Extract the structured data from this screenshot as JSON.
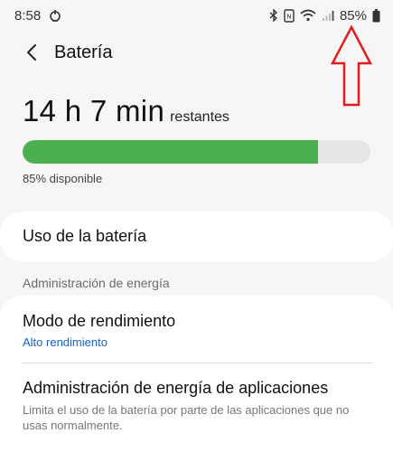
{
  "status_bar": {
    "time": "8:58",
    "battery_percent": "85%",
    "icons": [
      "notification-app-icon",
      "bluetooth-icon",
      "nfc-icon",
      "wifi-icon",
      "signal-icon",
      "battery-icon"
    ]
  },
  "header": {
    "back_icon": "chevron-left-icon",
    "title": "Batería"
  },
  "battery": {
    "time_remaining": "14 h 7 min",
    "time_suffix": "restantes",
    "level_fraction": 0.85,
    "available_text": "85% disponible",
    "bar_color": "#4caf50"
  },
  "usage": {
    "label": "Uso de la batería"
  },
  "power_section": {
    "header": "Administración de energía",
    "items": [
      {
        "title": "Modo de rendimiento",
        "subtitle": "Alto rendimiento"
      },
      {
        "title": "Administración de energía de aplicaciones",
        "subtitle": "Limita el uso de la batería por parte de las aplicaciones que no usas normalmente."
      }
    ]
  },
  "annotation": {
    "arrow_color": "#e21b1b"
  },
  "colors": {
    "background": "#f6f6f6",
    "card": "#ffffff",
    "link_blue": "#1565c0"
  }
}
